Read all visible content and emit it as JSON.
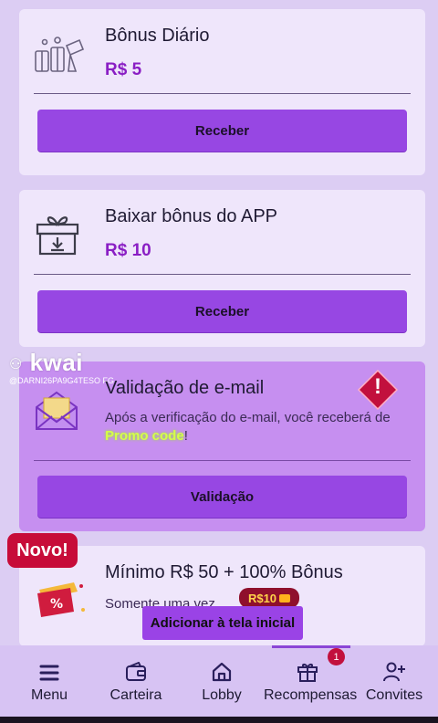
{
  "bonus_daily": {
    "title": "Bônus Diário",
    "amount": "R$ 5",
    "button": "Receber"
  },
  "bonus_app": {
    "title": "Baixar bônus do APP",
    "amount": "R$ 10",
    "button": "Receber"
  },
  "email_validation": {
    "title": "Validação de e-mail",
    "desc_before": "Após a verificação do e-mail, você receberá de ",
    "promo": "Promo code",
    "desc_after": "!",
    "button": "Validação",
    "alert_symbol": "!"
  },
  "promo_card": {
    "badge": "Novo!",
    "title": "Mínimo R$ 50 + 100% Bônus",
    "subtitle": "Somente uma vez",
    "coupon": "R$10"
  },
  "watermark": {
    "brand": "kwai",
    "id": "@DARNI26PA9G4TESO FG"
  },
  "add_home": "Adicionar à tela inicial",
  "nav": {
    "items": [
      {
        "label": "Menu",
        "icon": "menu-icon"
      },
      {
        "label": "Carteira",
        "icon": "wallet-icon"
      },
      {
        "label": "Lobby",
        "icon": "home-icon"
      },
      {
        "label": "Recompensas",
        "icon": "gift-icon"
      },
      {
        "label": "Convites",
        "icon": "add-user-icon"
      }
    ],
    "badge_count": "1"
  },
  "colors": {
    "accent": "#9747e3",
    "amount": "#8a1ec4",
    "alert": "#c2103d"
  }
}
